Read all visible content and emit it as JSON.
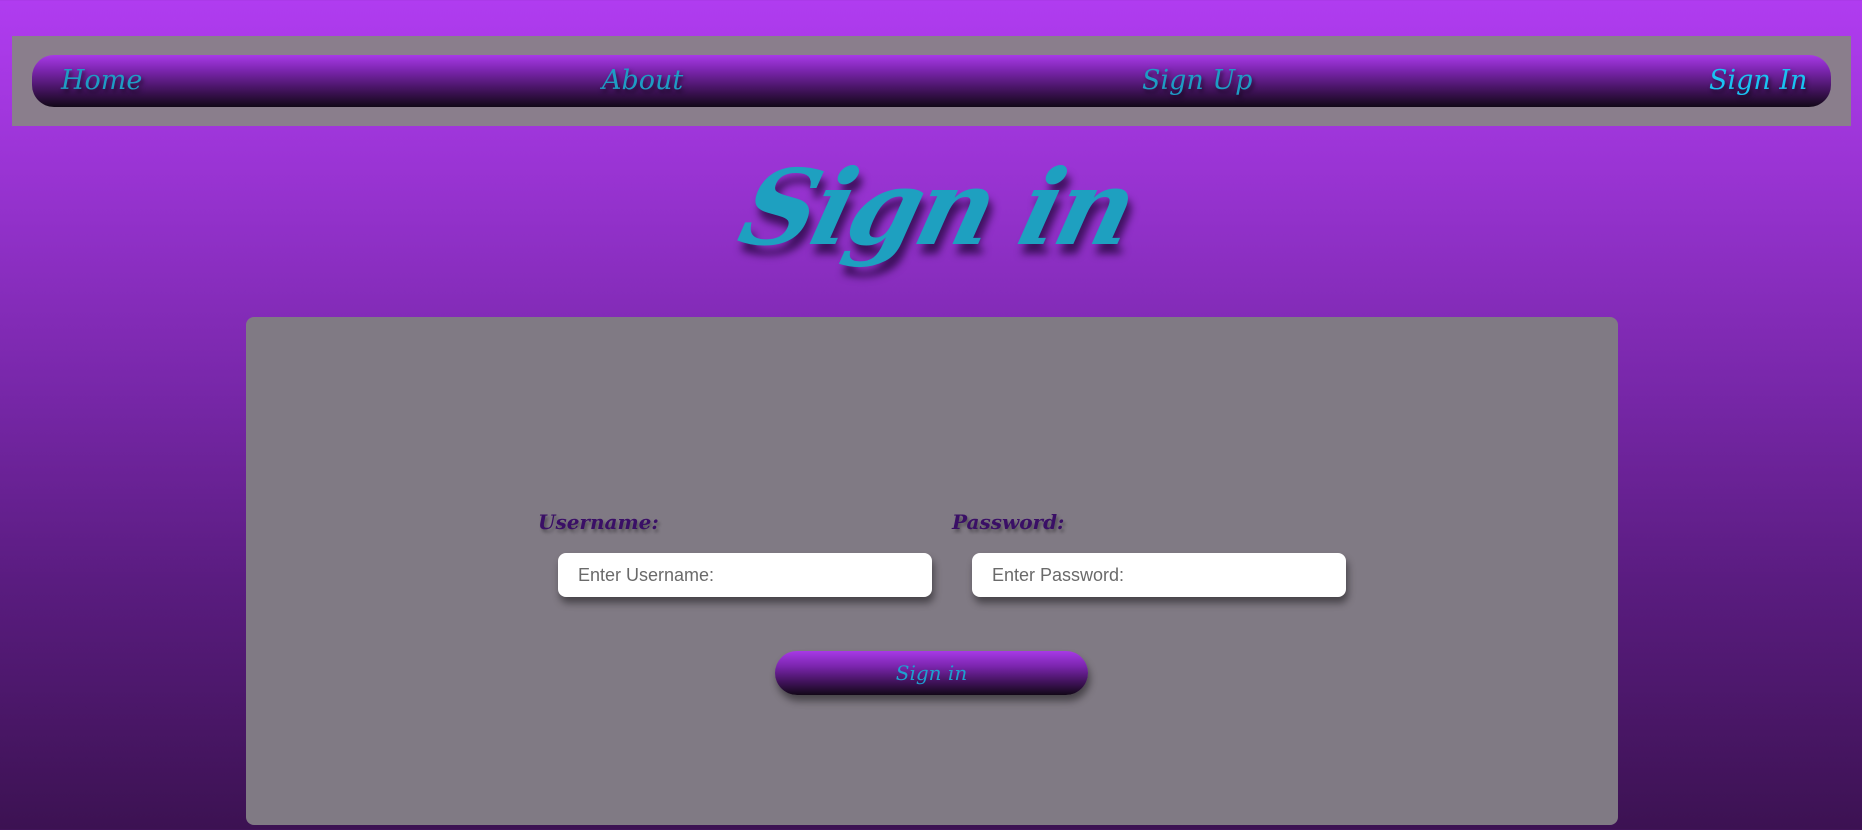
{
  "nav": {
    "items": [
      {
        "label": "Home",
        "active": false
      },
      {
        "label": "About",
        "active": false
      },
      {
        "label": "Sign Up",
        "active": false
      },
      {
        "label": "Sign In",
        "active": true
      }
    ]
  },
  "page": {
    "title": "Sign in"
  },
  "form": {
    "username": {
      "label": "Username:",
      "placeholder": "Enter Username:",
      "value": ""
    },
    "password": {
      "label": "Password:",
      "placeholder": "Enter Password:",
      "value": ""
    },
    "submit_label": "Sign in"
  },
  "colors": {
    "background_top": "#b03cf0",
    "background_bottom": "#3c1252",
    "nav_bar": "#8a7e8c",
    "card": "#807a84",
    "link_text": "#1e9cc4",
    "label_text": "#3a0f66"
  }
}
